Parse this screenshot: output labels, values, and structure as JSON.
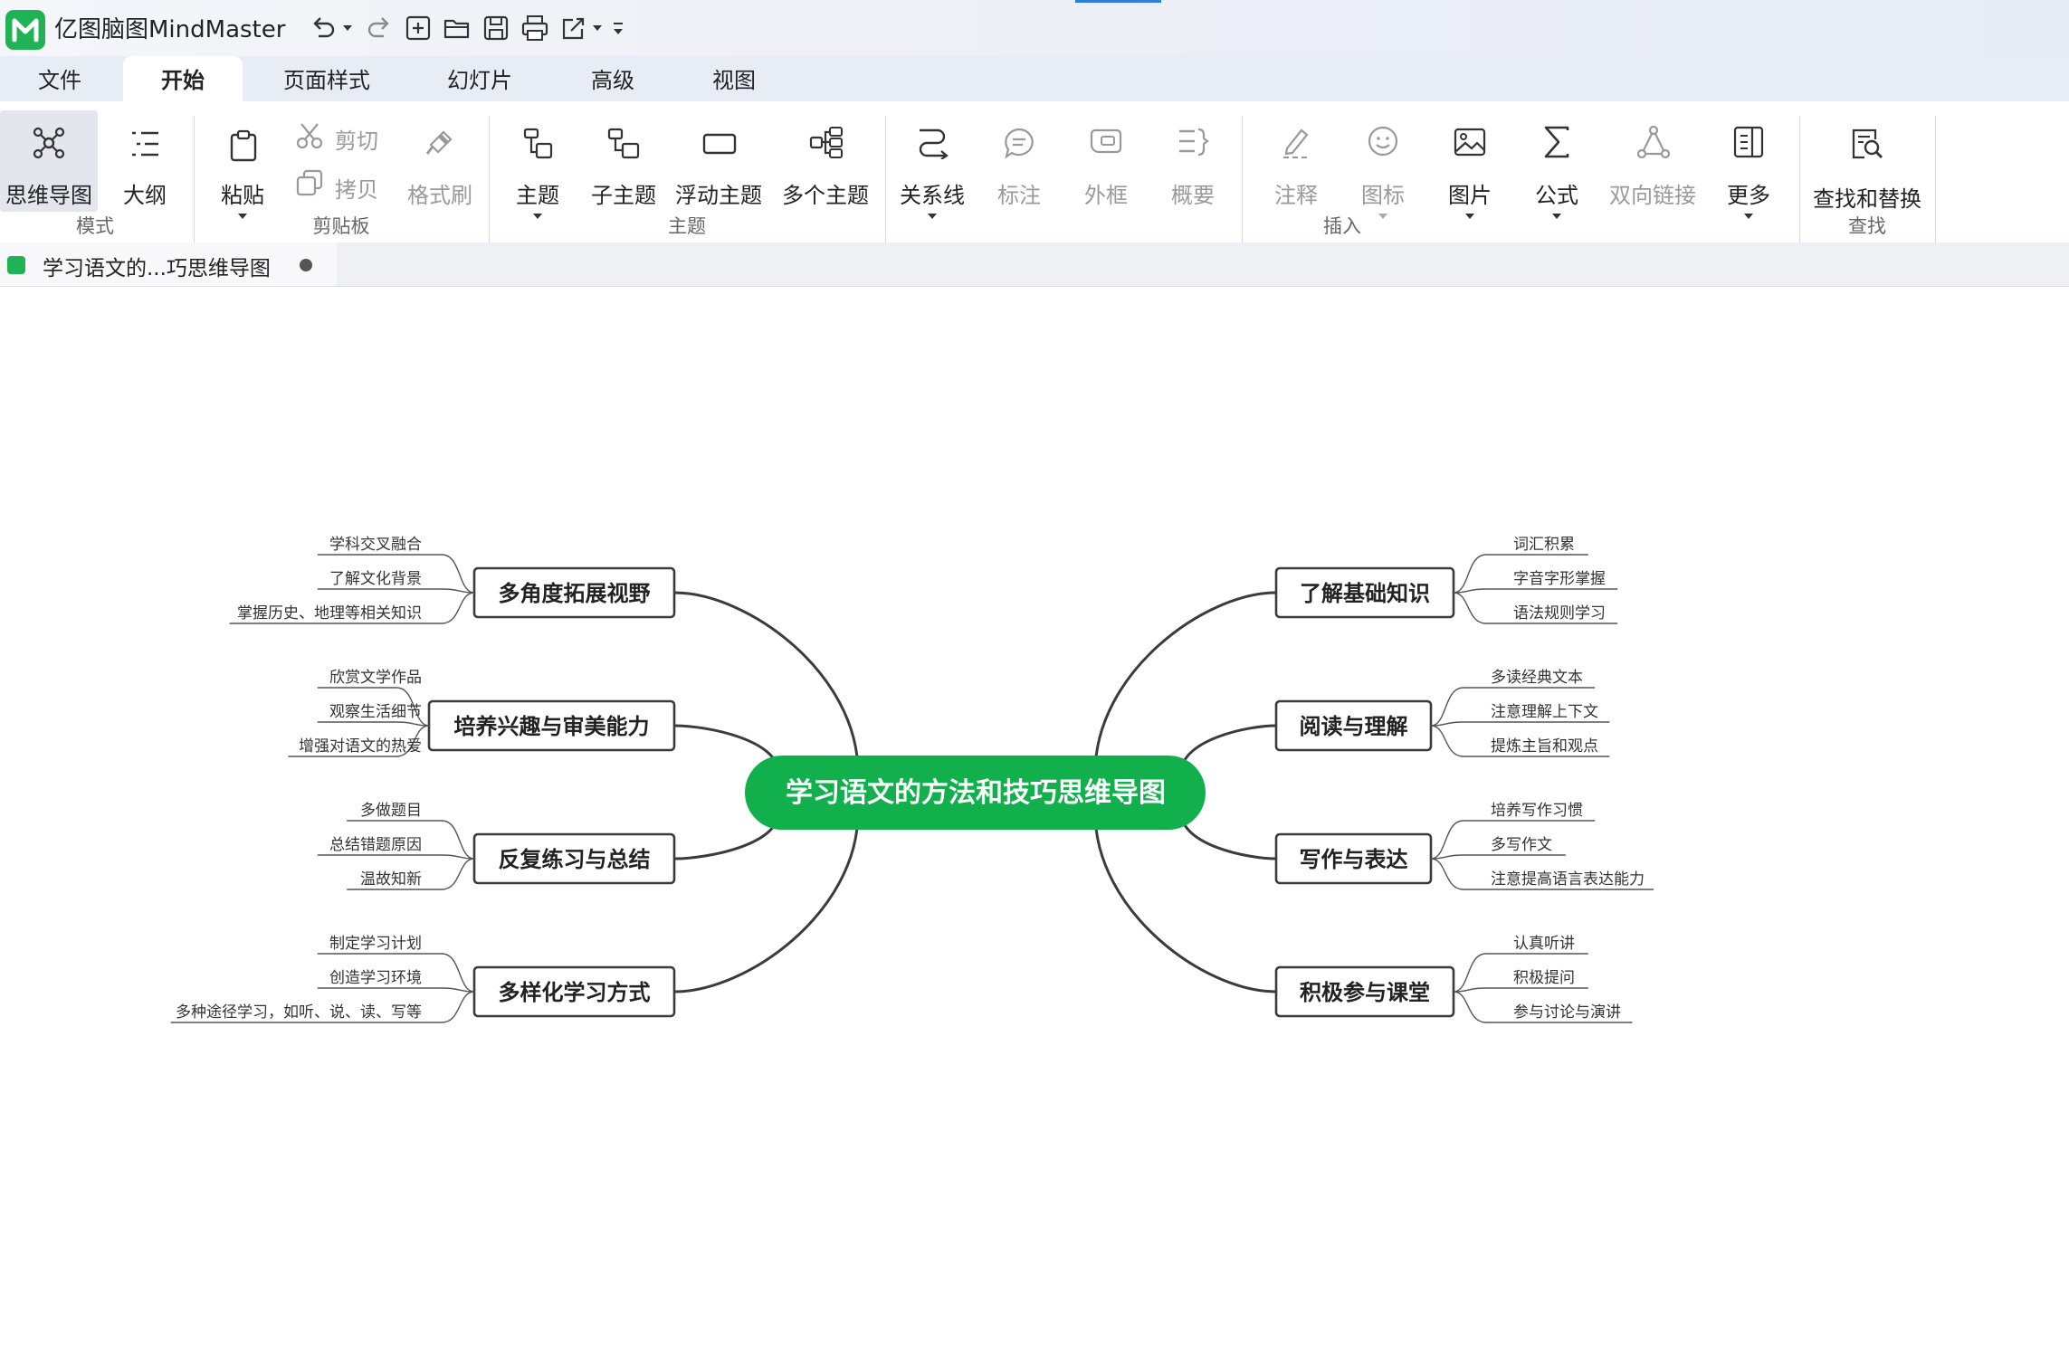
{
  "app": {
    "title": "亿图脑图MindMaster",
    "quick_access": [
      "undo-icon",
      "redo-icon",
      "new-icon",
      "open-folder-icon",
      "save-icon",
      "print-icon",
      "export-icon",
      "customize-icon"
    ]
  },
  "menu": {
    "tabs": [
      "文件",
      "开始",
      "页面样式",
      "幻灯片",
      "高级",
      "视图"
    ],
    "active": "开始"
  },
  "ribbon": {
    "mode": {
      "label": "模式",
      "mindmap": "思维导图",
      "outline": "大纲"
    },
    "clipboard": {
      "label": "剪贴板",
      "paste": "粘贴",
      "cut": "剪切",
      "copy": "拷贝",
      "format_painter": "格式刷"
    },
    "topic": {
      "label": "主题",
      "topic": "主题",
      "subtopic": "子主题",
      "floating": "浮动主题",
      "multiple": "多个主题"
    },
    "insert": {
      "label": "插入",
      "relation": "关系线",
      "callout": "标注",
      "boundary": "外框",
      "summary": "概要",
      "note": "注释",
      "icon": "图标",
      "image": "图片",
      "formula": "公式",
      "bilink": "双向链接",
      "more": "更多"
    },
    "find": {
      "label": "查找",
      "find_replace": "查找和替换"
    }
  },
  "document_tab": {
    "title": "学习语文的...巧思维导图"
  },
  "colors": {
    "brand": "#1fb356",
    "root_fill": "#12b04d",
    "line": "#3b3b3b"
  },
  "mindmap": {
    "root": "学习语文的方法和技巧思维导图",
    "left": [
      {
        "topic": "多角度拓展视野",
        "children": [
          "学科交叉融合",
          "了解文化背景",
          "掌握历史、地理等相关知识"
        ]
      },
      {
        "topic": "培养兴趣与审美能力",
        "children": [
          "欣赏文学作品",
          "观察生活细节",
          "增强对语文的热爱"
        ]
      },
      {
        "topic": "反复练习与总结",
        "children": [
          "多做题目",
          "总结错题原因",
          "温故知新"
        ]
      },
      {
        "topic": "多样化学习方式",
        "children": [
          "制定学习计划",
          "创造学习环境",
          "多种途径学习，如听、说、读、写等"
        ]
      }
    ],
    "right": [
      {
        "topic": "了解基础知识",
        "children": [
          "词汇积累",
          "字音字形掌握",
          "语法规则学习"
        ]
      },
      {
        "topic": "阅读与理解",
        "children": [
          "多读经典文本",
          "注意理解上下文",
          "提炼主旨和观点"
        ]
      },
      {
        "topic": "写作与表达",
        "children": [
          "培养写作习惯",
          "多写作文",
          "注意提高语言表达能力"
        ]
      },
      {
        "topic": "积极参与课堂",
        "children": [
          "认真听讲",
          "积极提问",
          "参与讨论与演讲"
        ]
      }
    ]
  }
}
